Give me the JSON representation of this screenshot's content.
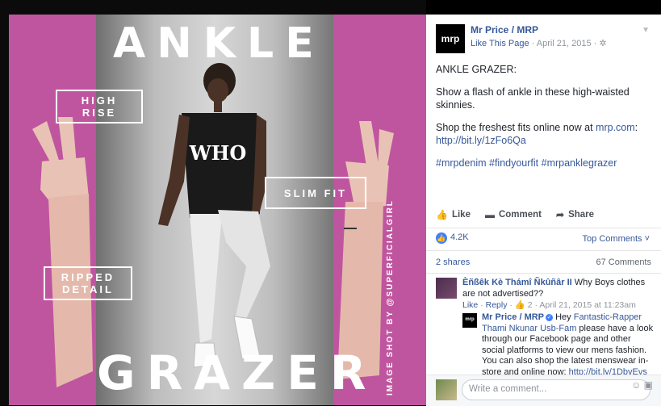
{
  "photo": {
    "title_top": "ANKLE",
    "title_bottom": "GRAZER",
    "tag_high_rise": "HIGH\nRISE",
    "tag_slim_fit": "SLIM FIT",
    "tag_ripped": "RIPPED\nDETAIL",
    "credit": "IMAGE SHOT BY @SUPERFICIALGIRL",
    "shirt_text": "WHO"
  },
  "post": {
    "avatar_text": "mrp",
    "page_name": "Mr Price / MRP",
    "like_page": "Like This Page",
    "date": " · April 21, 2015 · ",
    "body1": "ANKLE GRAZER:",
    "body2": "Show a flash of ankle in these high-waisted skinnies.",
    "body3_prefix": "Shop the freshest fits online now at ",
    "body3_link1": "mrp.com",
    "body3_sep": ": ",
    "body3_link2": "http://bit.ly/1zFo6Qa",
    "hashtags": "#mrpdenim #findyourfit #mrpanklegrazer"
  },
  "actions": {
    "like": "Like",
    "comment": "Comment",
    "share": "Share"
  },
  "reactions": {
    "count": "4.2K",
    "top_comments": "Top Comments ˅"
  },
  "stats": {
    "shares": "2 shares",
    "comments": "67 Comments"
  },
  "comments": {
    "c1_name": "Èñßêk Kè Thámî Ñkûñâr II",
    "c1_text": " Why Boys clothes are not advertised??",
    "c1_like": "Like",
    "c1_reply": "Reply",
    "c1_meta_rest": " · 👍 2 · April 21, 2015 at 11:23am",
    "c2_avatar": "mrp",
    "c2_name": "Mr Price / MRP",
    "c2_prefix": " Hey ",
    "c2_mention": "Fantastic-Rapper Thami Nkunar Usb-Fam",
    "c2_text": " please have a look through our Facebook page and other social platforms to view our mens fashion. You can also shop the latest menswear in-store and online now: ",
    "c2_link": "http://bit.ly/1DbvEvs"
  },
  "write": {
    "placeholder": "Write a comment...",
    "icons": "☺ ▣"
  },
  "colors": {
    "accent": "#365899",
    "magenta": "#c0559f"
  }
}
